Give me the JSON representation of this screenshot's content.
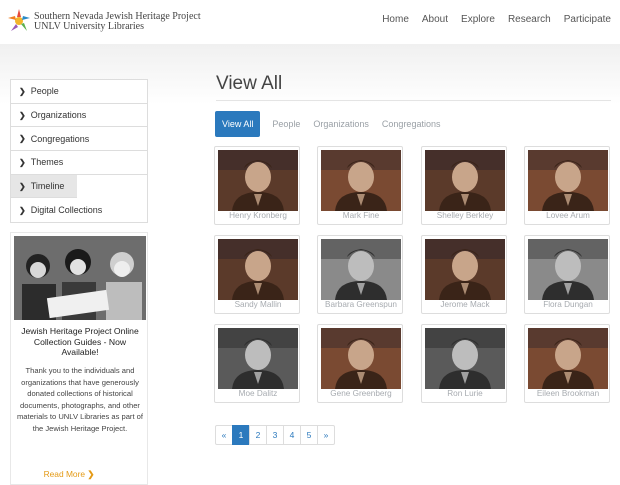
{
  "header": {
    "org_name": "Southern Nevada Jewish Heritage Project",
    "org_sub": "UNLV University Libraries",
    "nav": [
      "Home",
      "About",
      "Explore",
      "Research",
      "Participate"
    ]
  },
  "sidebar": {
    "items": [
      {
        "label": "People"
      },
      {
        "label": "Organizations"
      },
      {
        "label": "Congregations"
      },
      {
        "label": "Themes"
      },
      {
        "label": "Timeline"
      },
      {
        "label": "Digital Collections"
      }
    ],
    "active_index": 4
  },
  "promo": {
    "title": "Jewish Heritage Project Online Collection Guides - Now Available!",
    "body": "Thank you to the individuals and organizations that have generously donated collections of historical documents, photographs, and other materials to UNLV Libraries as part of the Jewish Heritage Project.",
    "link": "Read More"
  },
  "main": {
    "title": "View All",
    "tabs": [
      {
        "label": "View All",
        "active": true
      },
      {
        "label": "People",
        "active": false
      },
      {
        "label": "Organizations",
        "active": false
      },
      {
        "label": "Congregations",
        "active": false
      }
    ],
    "people": [
      {
        "name": "Henry Kronberg",
        "tone": "color"
      },
      {
        "name": "Mark Fine",
        "tone": "color"
      },
      {
        "name": "Shelley Berkley",
        "tone": "color"
      },
      {
        "name": "Lovee Arum",
        "tone": "color"
      },
      {
        "name": "Sandy Mallin",
        "tone": "color"
      },
      {
        "name": "Barbara Greenspun",
        "tone": "bw"
      },
      {
        "name": "Jerome Mack",
        "tone": "color"
      },
      {
        "name": "Flora Dungan",
        "tone": "bw"
      },
      {
        "name": "Moe Dalitz",
        "tone": "bw"
      },
      {
        "name": "Gene Greenberg",
        "tone": "color"
      },
      {
        "name": "Ron Lurie",
        "tone": "bw"
      },
      {
        "name": "Eileen Brookman",
        "tone": "color"
      }
    ]
  },
  "pagination": {
    "prev": "«",
    "pages": [
      "1",
      "2",
      "3",
      "4",
      "5"
    ],
    "next": "»",
    "current": "1"
  }
}
